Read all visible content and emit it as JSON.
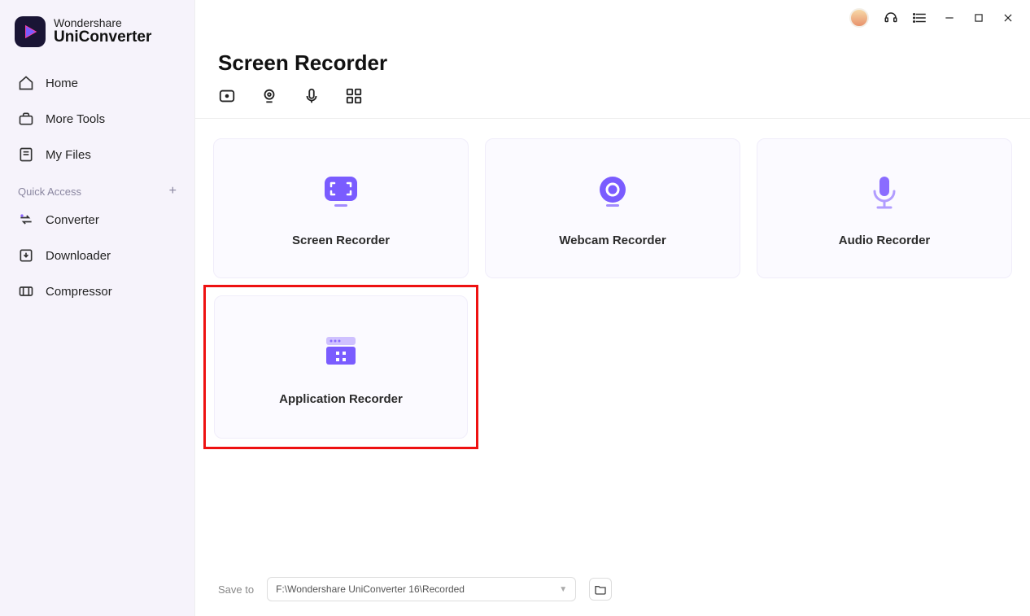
{
  "brand": {
    "line1": "Wondershare",
    "line2": "UniConverter"
  },
  "sidebar": {
    "items": [
      {
        "label": "Home"
      },
      {
        "label": "More Tools"
      },
      {
        "label": "My Files"
      }
    ],
    "quick_access_label": "Quick Access",
    "quick_items": [
      {
        "label": "Converter"
      },
      {
        "label": "Downloader"
      },
      {
        "label": "Compressor"
      }
    ]
  },
  "page": {
    "title": "Screen Recorder"
  },
  "cards": [
    {
      "label": "Screen Recorder"
    },
    {
      "label": "Webcam Recorder"
    },
    {
      "label": "Audio Recorder"
    },
    {
      "label": "Application Recorder"
    }
  ],
  "save_bar": {
    "label": "Save to",
    "path": "F:\\Wondershare UniConverter 16\\Recorded"
  }
}
